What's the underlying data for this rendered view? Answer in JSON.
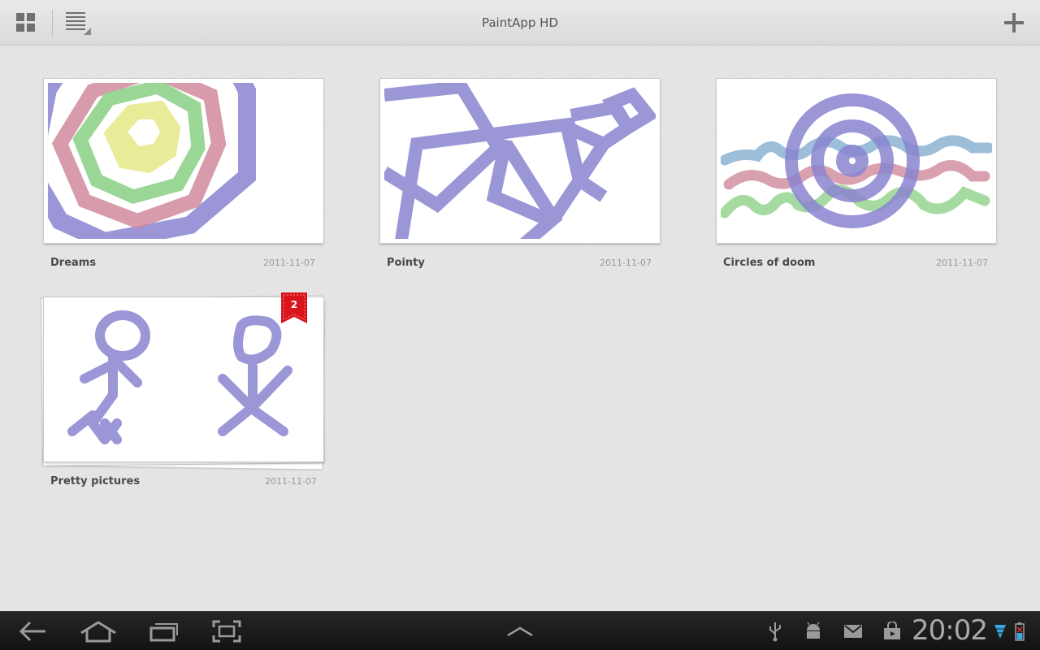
{
  "app": {
    "title": "PaintApp HD"
  },
  "actionbar": {
    "grid_icon": "grid-view-icon",
    "list_icon": "list-view-icon",
    "add_icon": "plus-icon"
  },
  "drawings": [
    {
      "title": "Dreams",
      "date": "2011-11-07"
    },
    {
      "title": "Pointy",
      "date": "2011-11-07"
    },
    {
      "title": "Circles of doom",
      "date": "2011-11-07"
    },
    {
      "title": "Pretty pictures",
      "date": "2011-11-07",
      "badge": "2"
    }
  ],
  "colors": {
    "stroke_purple": "#8a84d0",
    "stroke_pink": "#d08a9c",
    "stroke_green": "#8fd18a",
    "stroke_yellow": "#e8ec98",
    "stroke_blue": "#84aed0",
    "badge_red": "#d9141b"
  },
  "systembar": {
    "back_icon": "back-icon",
    "home_icon": "home-icon",
    "recents_icon": "recent-apps-icon",
    "screenshot_icon": "screenshot-icon",
    "menu_icon": "chevron-up-icon",
    "usb_icon": "usb-icon",
    "android_icon": "android-debug-icon",
    "gmail_icon": "gmail-icon",
    "market_icon": "market-icon",
    "clock": "20:02",
    "wifi_icon": "wifi-icon",
    "battery_icon": "battery-icon"
  }
}
